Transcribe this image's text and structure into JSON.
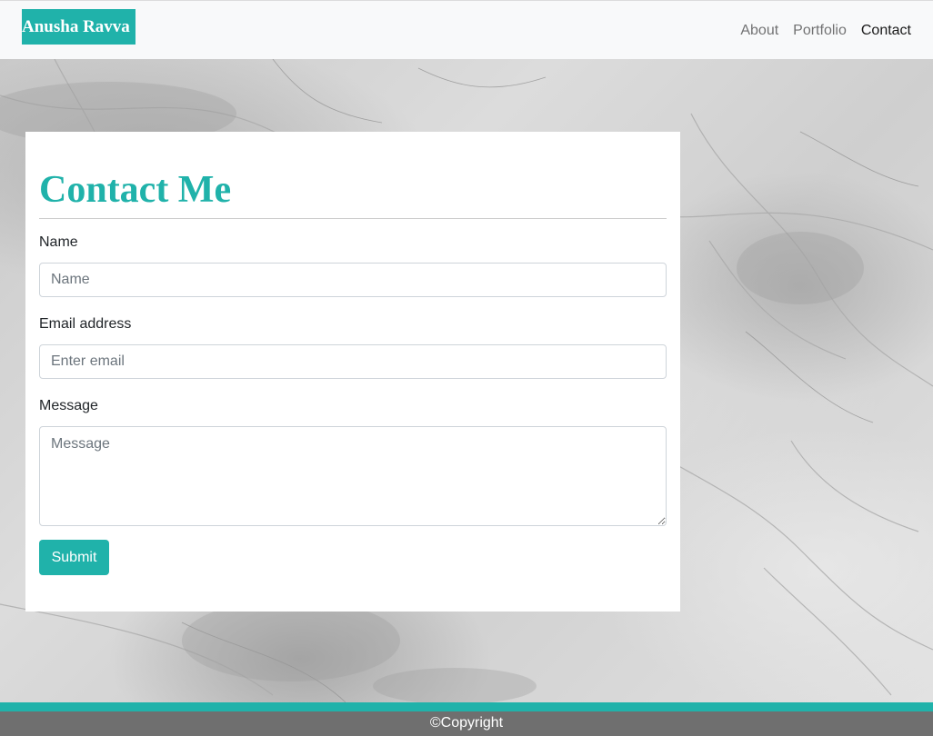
{
  "navbar": {
    "brand": "Anusha Ravva",
    "links": [
      "About",
      "Portfolio",
      "Contact"
    ],
    "active": "Contact"
  },
  "contact": {
    "title": "Contact Me",
    "name_label": "Name",
    "name_placeholder": "Name",
    "email_label": "Email address",
    "email_placeholder": "Enter email",
    "message_label": "Message",
    "message_placeholder": "Message",
    "submit_label": "Submit"
  },
  "footer": {
    "text": "©Copyright"
  },
  "colors": {
    "accent": "#20b2aa",
    "navbar_bg": "#f8f9fa",
    "footer_bg": "#6f6f6f"
  }
}
